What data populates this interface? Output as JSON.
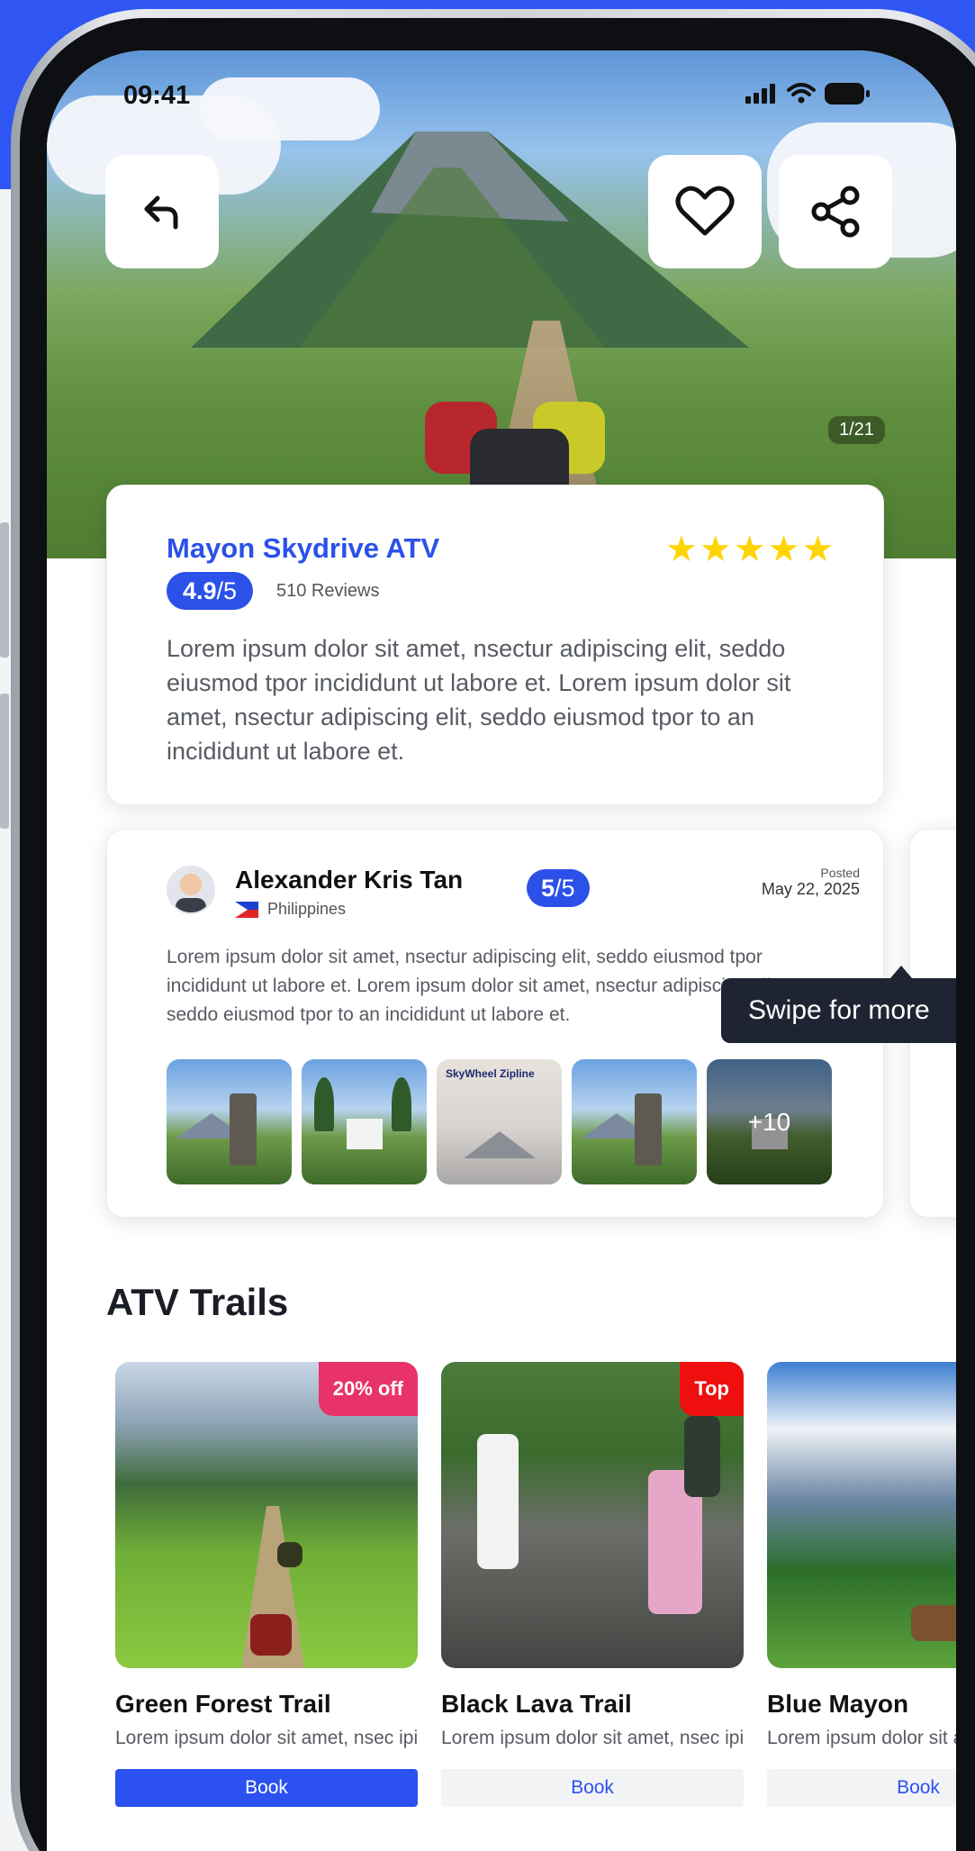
{
  "status_bar": {
    "time": "09:41"
  },
  "hero": {
    "photo_counter": "1/21"
  },
  "place": {
    "title": "Mayon Skydrive ATV",
    "stars": "★★★★★",
    "rating_value": "4.9",
    "rating_suffix": "/5",
    "review_count": "510 Reviews",
    "description": "Lorem ipsum dolor sit amet, nsectur adipiscing elit, seddo eiusmod tpor incididunt ut labore et. Lorem ipsum dolor sit amet, nsectur adipiscing elit, seddo eiusmod tpor to an incididunt ut labore et."
  },
  "review": {
    "name": "Alexander Kris Tan",
    "country": "Philippines",
    "score_value": "5",
    "score_suffix": "/5",
    "posted_label": "Posted",
    "posted_date": "May 22, 2025",
    "text": "Lorem ipsum dolor sit amet, nsectur adipiscing elit, seddo eiusmod tpor incididunt ut labore et. Lorem ipsum dolor sit amet, nsectur adipiscing elit, seddo eiusmod tpor to an incididunt ut labore et.",
    "photo_sign": "SkyWheel Zipline",
    "more_photos": "+10"
  },
  "tooltip": {
    "text": "Swipe for more"
  },
  "section": {
    "title": "ATV Trails"
  },
  "trails": [
    {
      "name": "Green Forest Trail",
      "desc": "Lorem ipsum dolor sit amet, nsec ipiscing elit nsecturna fakfs.",
      "badge": "20% off",
      "badge_color": "#e8336a",
      "book": "Book"
    },
    {
      "name": "Black Lava Trail",
      "desc": "Lorem ipsum dolor sit amet, nsec ipiscing elit nsecturna fakfs.",
      "badge": "Top",
      "badge_color": "#f00f0f",
      "book": "Book"
    },
    {
      "name": "Blue Mayon",
      "desc": "Lorem ipsum dolor sit amet, nsec ipiscing elit nsecturna fakfs.",
      "book": "Book"
    }
  ],
  "colors": {
    "accent": "#2b51e8",
    "background": "#2f55f2",
    "star": "#ffd400"
  }
}
